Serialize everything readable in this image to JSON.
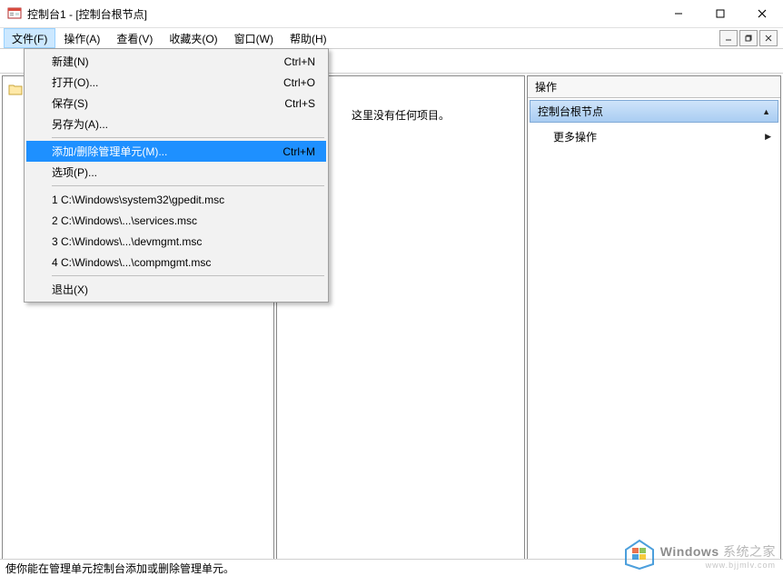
{
  "window": {
    "title": "控制台1 - [控制台根节点]"
  },
  "menubar": {
    "items": [
      {
        "label": "文件(F)",
        "active": true
      },
      {
        "label": "操作(A)",
        "active": false
      },
      {
        "label": "查看(V)",
        "active": false
      },
      {
        "label": "收藏夹(O)",
        "active": false
      },
      {
        "label": "窗口(W)",
        "active": false
      },
      {
        "label": "帮助(H)",
        "active": false
      }
    ]
  },
  "dropdown": {
    "g1": [
      {
        "label": "新建(N)",
        "shortcut": "Ctrl+N",
        "hl": false
      },
      {
        "label": "打开(O)...",
        "shortcut": "Ctrl+O",
        "hl": false
      },
      {
        "label": "保存(S)",
        "shortcut": "Ctrl+S",
        "hl": false
      },
      {
        "label": "另存为(A)...",
        "shortcut": "",
        "hl": false
      }
    ],
    "g2": [
      {
        "label": "添加/删除管理单元(M)...",
        "shortcut": "Ctrl+M",
        "hl": true
      },
      {
        "label": "选项(P)...",
        "shortcut": "",
        "hl": false
      }
    ],
    "g3": [
      {
        "label": "1 C:\\Windows\\system32\\gpedit.msc",
        "shortcut": "",
        "hl": false
      },
      {
        "label": "2 C:\\Windows\\...\\services.msc",
        "shortcut": "",
        "hl": false
      },
      {
        "label": "3 C:\\Windows\\...\\devmgmt.msc",
        "shortcut": "",
        "hl": false
      },
      {
        "label": "4 C:\\Windows\\...\\compmgmt.msc",
        "shortcut": "",
        "hl": false
      }
    ],
    "g4": [
      {
        "label": "退出(X)",
        "shortcut": "",
        "hl": false
      }
    ]
  },
  "content": {
    "empty_text": "这里没有任何项目。"
  },
  "actions": {
    "header": "操作",
    "section_title": "控制台根节点",
    "more_actions": "更多操作"
  },
  "statusbar": {
    "text": "使你能在管理单元控制台添加或删除管理单元。"
  },
  "watermark": {
    "main1": "Windows",
    "main2": " 系统之家",
    "sub": "www.bjjmlv.com"
  }
}
